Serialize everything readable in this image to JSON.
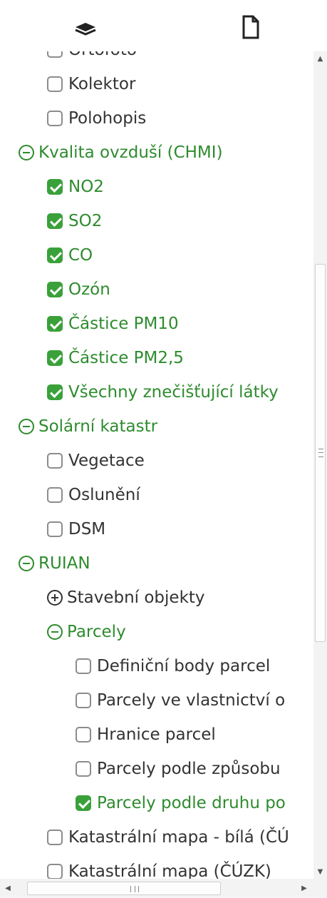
{
  "toolbar": {
    "layers_icon": "layers-icon",
    "document_icon": "document-icon"
  },
  "tree": [
    {
      "label": "Ortofoto",
      "type": "checkbox",
      "checked": false
    },
    {
      "label": "Kolektor",
      "type": "checkbox",
      "checked": false
    },
    {
      "label": "Polohopis",
      "type": "checkbox",
      "checked": false
    },
    {
      "label": "Kvalita ovzduší (CHMI)",
      "type": "group",
      "expanded": true
    },
    {
      "label": "NO2",
      "type": "checkbox",
      "checked": true
    },
    {
      "label": "SO2",
      "type": "checkbox",
      "checked": true
    },
    {
      "label": "CO",
      "type": "checkbox",
      "checked": true
    },
    {
      "label": "Ozón",
      "type": "checkbox",
      "checked": true
    },
    {
      "label": "Částice PM10",
      "type": "checkbox",
      "checked": true
    },
    {
      "label": "Částice PM2,5",
      "type": "checkbox",
      "checked": true
    },
    {
      "label": "Všechny znečišťující látky",
      "type": "checkbox",
      "checked": true
    },
    {
      "label": "Solární katastr",
      "type": "group",
      "expanded": true
    },
    {
      "label": "Vegetace",
      "type": "checkbox",
      "checked": false
    },
    {
      "label": "Oslunění",
      "type": "checkbox",
      "checked": false
    },
    {
      "label": "DSM",
      "type": "checkbox",
      "checked": false
    },
    {
      "label": "RUIAN",
      "type": "group",
      "expanded": true
    },
    {
      "label": "Stavební objekty",
      "type": "group",
      "expanded": false
    },
    {
      "label": "Parcely",
      "type": "group",
      "expanded": true
    },
    {
      "label": "Definiční body parcel",
      "type": "checkbox",
      "checked": false
    },
    {
      "label": "Parcely ve vlastnictví o",
      "type": "checkbox",
      "checked": false
    },
    {
      "label": "Hranice parcel",
      "type": "checkbox",
      "checked": false
    },
    {
      "label": "Parcely podle způsobu",
      "type": "checkbox",
      "checked": false
    },
    {
      "label": "Parcely podle druhu po",
      "type": "checkbox",
      "checked": true
    },
    {
      "label": "Katastrální mapa - bílá (ČÚ",
      "type": "checkbox",
      "checked": false
    },
    {
      "label": "Katastrální mapa (ČÚZK)",
      "type": "checkbox",
      "checked": false
    }
  ],
  "colors": {
    "accent_green": "#3aa13a",
    "text_green": "#2e8b2e",
    "text_default": "#333333"
  }
}
